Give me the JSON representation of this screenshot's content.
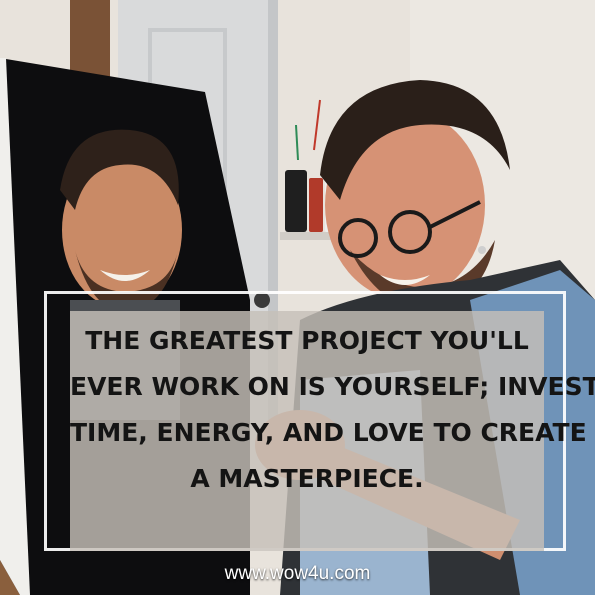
{
  "quote": {
    "lines": [
      "THE GREATEST PROJECT YOU'LL",
      "EVER WORK ON IS YOURSELF; INVEST",
      "TIME, ENERGY, AND LOVE TO CREATE",
      "A MASTERPIECE."
    ]
  },
  "site": {
    "url": "www.wow4u.com"
  }
}
